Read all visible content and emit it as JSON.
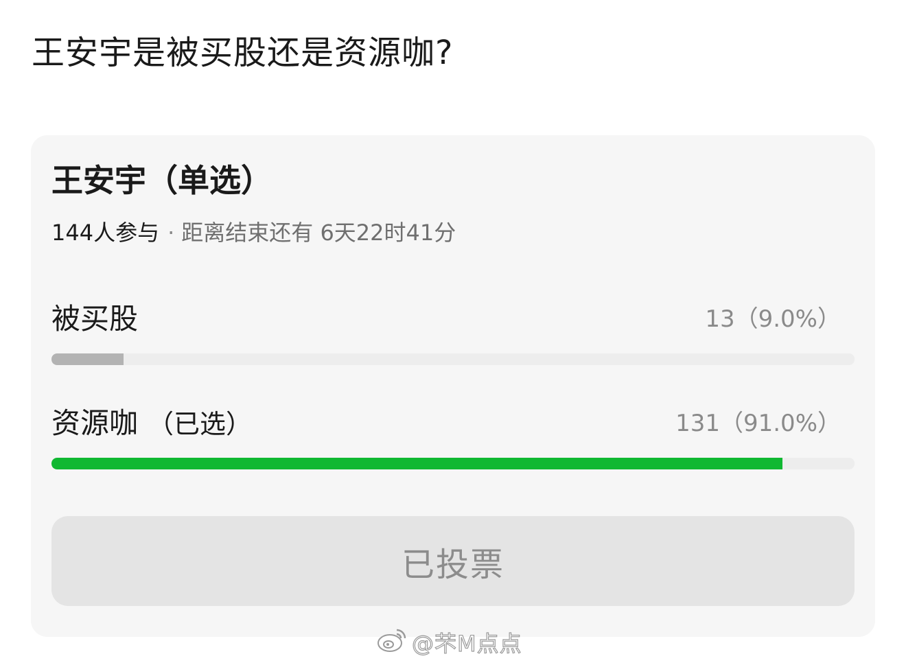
{
  "question": "王安宇是被买股还是资源咖?",
  "poll": {
    "title": "王安宇（单选）",
    "participants": "144人参与",
    "separator": "·",
    "remaining": "距离结束还有 6天22时41分",
    "options": [
      {
        "label": "被买股",
        "chosen_mark": "",
        "count": "13（9.0%）",
        "fraction": 0.09,
        "color": "#b3b3b3"
      },
      {
        "label": "资源咖",
        "chosen_mark": "（已选）",
        "count": "131（91.0%）",
        "fraction": 0.91,
        "color": "#10b832"
      }
    ],
    "vote_button_label": "已投票"
  },
  "watermark": {
    "logo": "weibo-logo",
    "text": "@芣M点点"
  }
}
